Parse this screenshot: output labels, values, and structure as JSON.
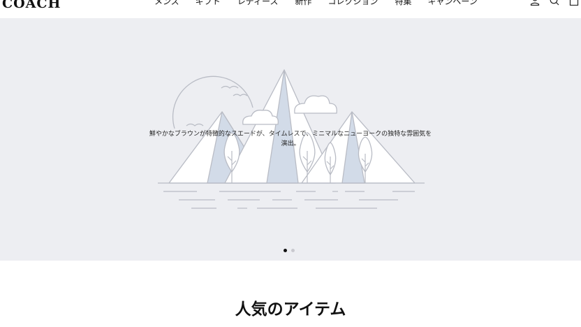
{
  "brand": {
    "logo_text": "COACH"
  },
  "nav": {
    "items": [
      {
        "label": "メンズ"
      },
      {
        "label": "ギフト"
      },
      {
        "label": "レディース"
      },
      {
        "label": "新作"
      },
      {
        "label": "コレクション"
      },
      {
        "label": "特集"
      },
      {
        "label": "キャンペーン"
      }
    ]
  },
  "utility_icons": [
    "account-icon",
    "search-icon",
    "bag-icon"
  ],
  "hero": {
    "caption_line1": "鮮やかなブラウンが特徴的なスエードが、タイムレスで、ミニマルなニューヨークの独特な雰囲気を",
    "caption_line2": "演出。",
    "slides_total": 2,
    "active_slide": 1
  },
  "section": {
    "title": "人気のアイテム"
  },
  "colors": {
    "hero_bg": "#edeef2",
    "line_art": "#b9bcc5",
    "mountain_fill": "#d2dbe8",
    "text": "#111111"
  }
}
